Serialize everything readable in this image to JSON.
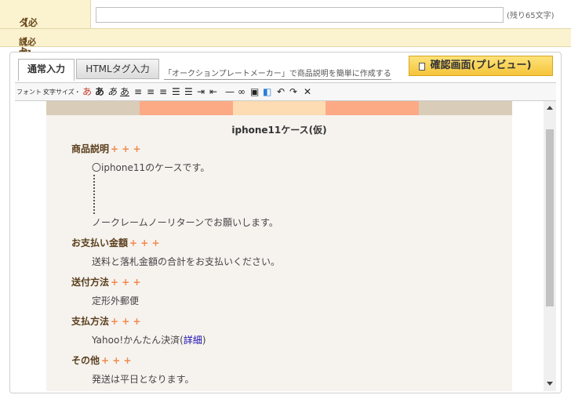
{
  "title_field": {
    "label": "タイトル",
    "required": "【必須】",
    "value": "",
    "remaining": "(残り65文字)"
  },
  "description_field": {
    "label": "説明",
    "required": "【必須】"
  },
  "tabs": [
    {
      "label": "通常入力"
    },
    {
      "label": "HTMLタグ入力"
    }
  ],
  "maker_link": "「オークションプレートメーカー」で商品説明を簡単に作成する",
  "preview_button": "確認画面(プレビュー)",
  "toolbar": {
    "font_label": "フォント・",
    "size_label": "文字サイズ・",
    "glyph_a": "あ"
  },
  "color_band": [
    "#d9cdb9",
    "#fcaa86",
    "#fddbb3",
    "#fcaa86",
    "#d9cdb9"
  ],
  "document": {
    "title": "iphone11ケース(仮)",
    "plus": "+ + +",
    "sections": [
      {
        "heading": "商品説明",
        "lines": [
          "〇iphone11のケースです。",
          "ノークレームノーリターンでお願いします。"
        ]
      },
      {
        "heading": "お支払い金額",
        "lines": [
          "送料と落札金額の合計をお支払いください。"
        ]
      },
      {
        "heading": "送付方法",
        "lines": [
          "定形外郵便"
        ]
      },
      {
        "heading": "支払方法",
        "text": "Yahoo!かんたん決済(",
        "link": "詳細",
        "close": ")"
      },
      {
        "heading": "その他",
        "lines": [
          "発送は平日となります。"
        ]
      }
    ]
  }
}
